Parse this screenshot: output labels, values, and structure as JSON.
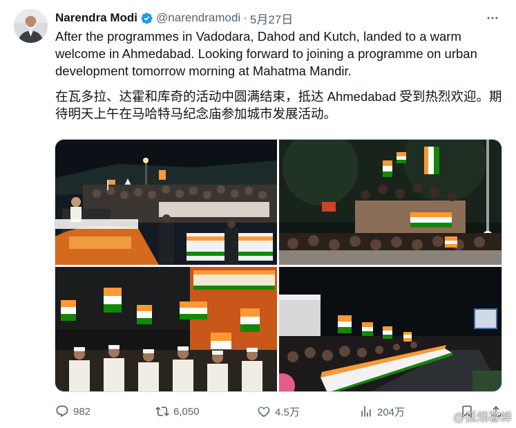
{
  "author": {
    "display_name": "Narendra Modi",
    "handle": "@narendramodi",
    "separator": "·",
    "date": "5月27日",
    "verified": true
  },
  "tweet": {
    "text_en": "After the programmes in Vadodara, Dahod and Kutch, landed to a warm welcome in Ahmedabad. Looking forward to joining a programme on urban development tomorrow morning at Mahatma Mandir.",
    "text_zh": "在瓦多拉、达霍和库奇的活动中圆满结束，抵达 Ahmedabad 受到热烈欢迎。期待明天上午在马哈特马纪念庙参加城市发展活动。"
  },
  "media": {
    "photo_count": 4,
    "photos": [
      {
        "subject": "night-roadshow-crowd-with-vehicle"
      },
      {
        "subject": "crowd-waving-flags-night"
      },
      {
        "subject": "supporters-waving-tricolour-flags"
      },
      {
        "subject": "crowd-lining-road-at-night"
      }
    ]
  },
  "actions": {
    "replies": "982",
    "reposts": "6,050",
    "likes": "4.5万",
    "views": "204万"
  },
  "icons": {
    "more": "more-horizontal-icon",
    "reply": "reply-icon",
    "repost": "repost-icon",
    "like": "heart-icon",
    "views": "views-chart-icon",
    "bookmark": "bookmark-icon",
    "share": "share-icon",
    "verified": "verified-badge-icon"
  },
  "watermark": {
    "text": "@孤烟暮蝉"
  },
  "colors": {
    "text_primary": "#0f1419",
    "text_secondary": "#536471",
    "verified_blue": "#1d9bf0",
    "border": "#cfd9de",
    "saffron": "#ff9933",
    "india_green": "#138808"
  }
}
